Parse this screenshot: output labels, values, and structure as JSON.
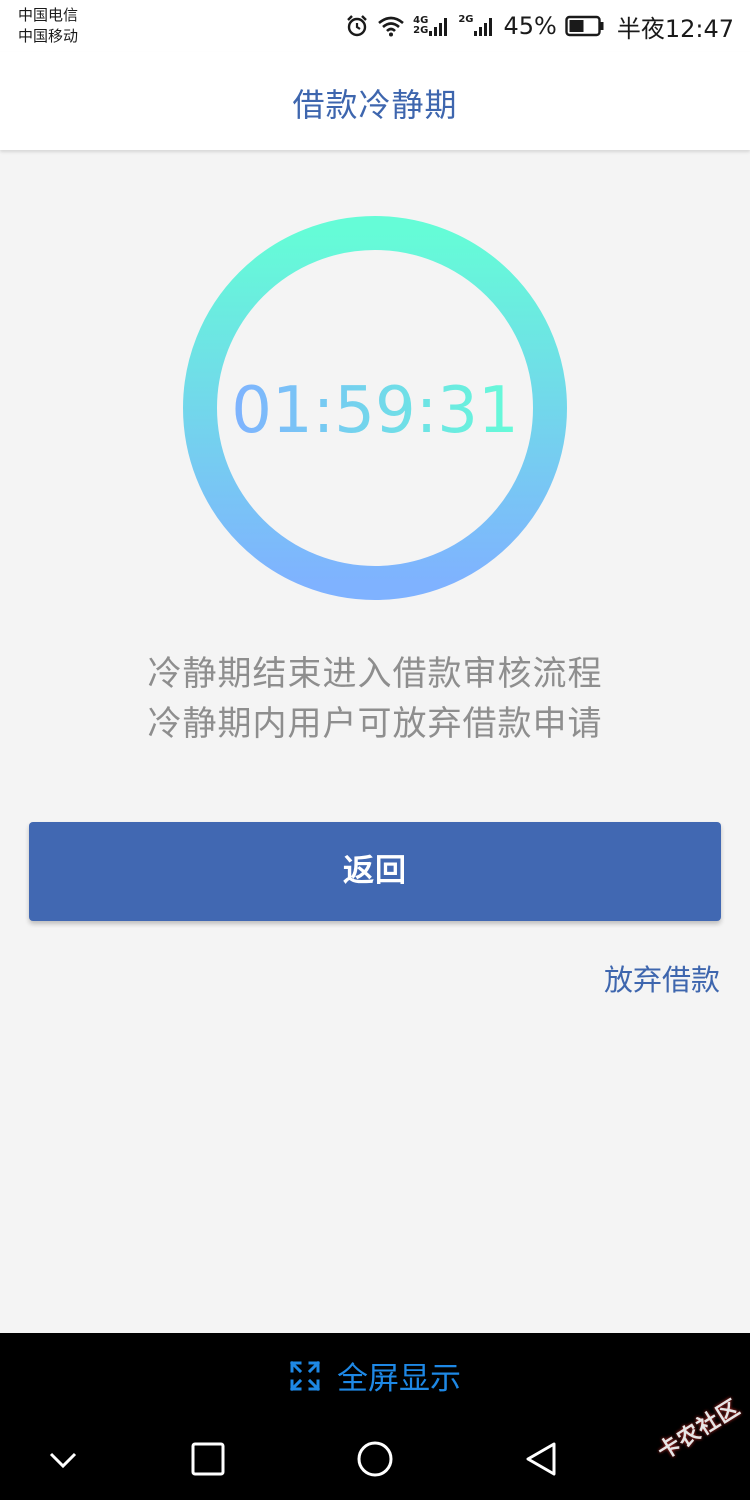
{
  "status_bar": {
    "carrier1": "中国电信",
    "carrier2": "中国移动",
    "signal1_label_top": "4G",
    "signal1_label_bottom": "2G",
    "signal2_label": "2G",
    "battery_percent": "45%",
    "time": "半夜12:47",
    "icons": [
      "alarm-icon",
      "wifi-icon",
      "signal-icon",
      "signal-icon",
      "battery-icon"
    ]
  },
  "header": {
    "title": "借款冷静期"
  },
  "countdown": {
    "time": "01:59:31",
    "ring_gradient": [
      "#65fcd7",
      "#7fb2ff"
    ]
  },
  "description": {
    "line1": "冷静期结束进入借款审核流程",
    "line2": "冷静期内用户可放弃借款申请"
  },
  "actions": {
    "back_label": "返回",
    "abandon_label": "放弃借款"
  },
  "fullscreen": {
    "label": "全屏显示",
    "icon": "expand-icon"
  },
  "nav": {
    "icons": [
      "chevron-down-icon",
      "recent-apps-icon",
      "home-icon",
      "back-icon"
    ]
  },
  "watermark": {
    "text": "卡农社区"
  },
  "colors": {
    "accent": "#4168b2",
    "title": "#3e66ae",
    "link_blue": "#1e88e5",
    "background": "#f4f4f4"
  }
}
